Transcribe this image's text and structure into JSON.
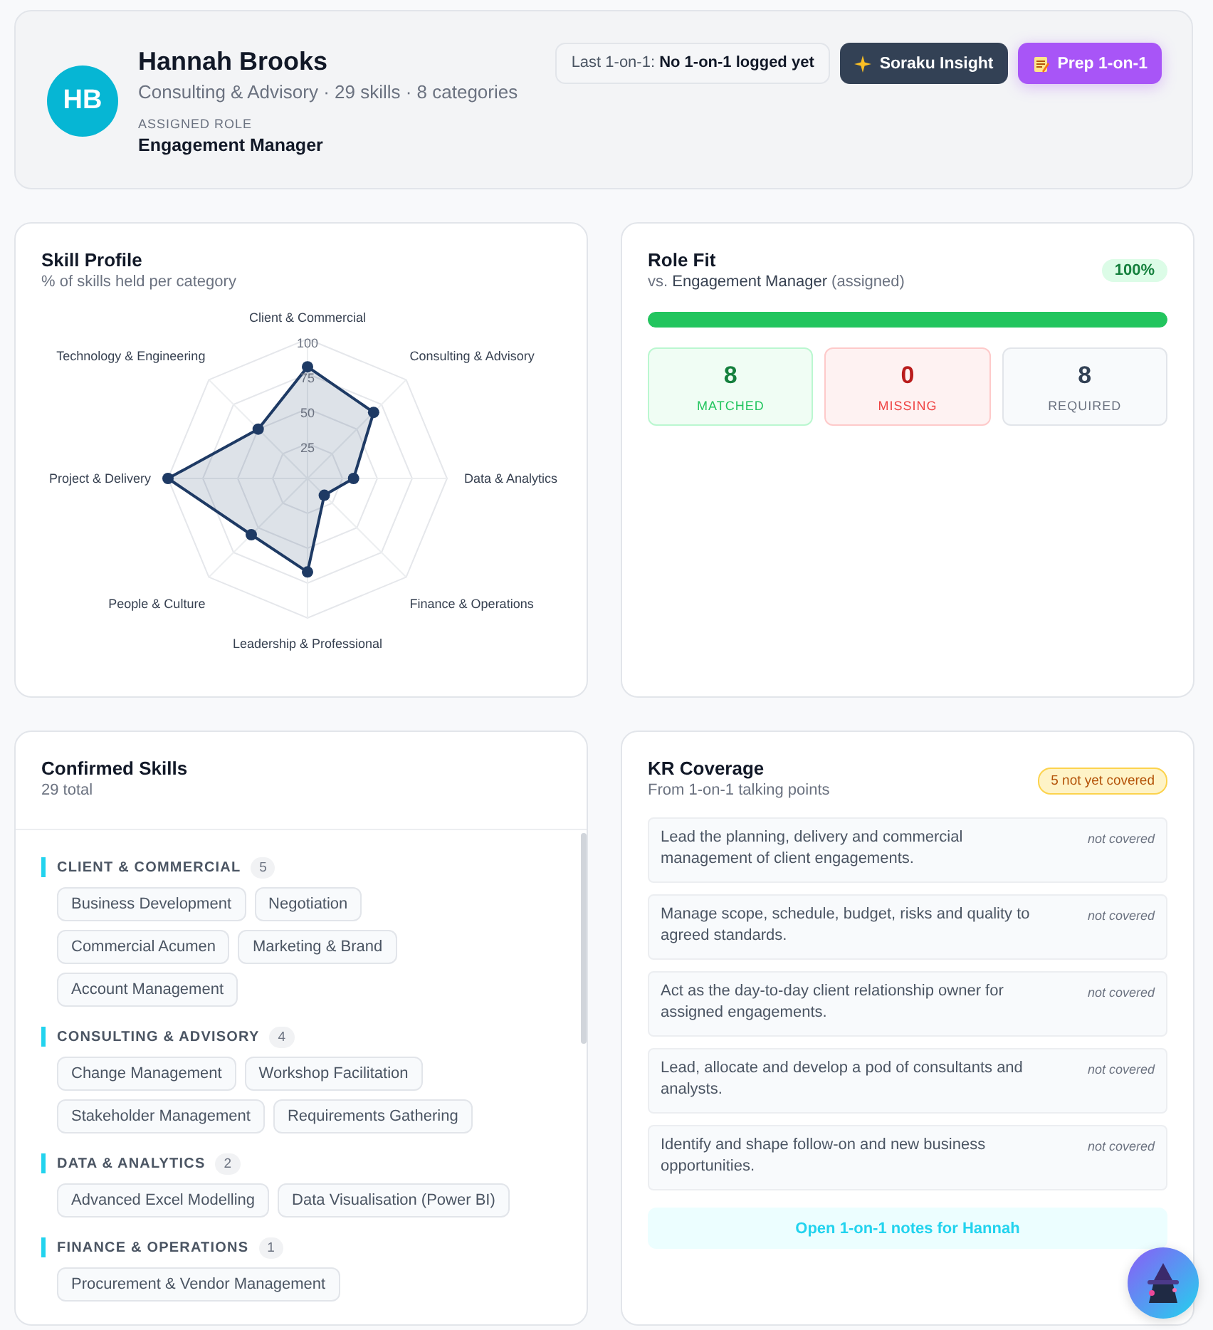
{
  "profile": {
    "initials": "HB",
    "name": "Hannah Brooks",
    "summary": "Consulting & Advisory · 29 skills · 8 categories",
    "role_label": "ASSIGNED ROLE",
    "role": "Engagement Manager",
    "last_one_on_one": "Last 1-on-1: **No 1-on-1 logged yet**",
    "buttons": [
      {
        "kind": "insight",
        "label": "Soraku Insight"
      },
      {
        "kind": "prep",
        "label": "Prep 1-on-1"
      }
    ]
  },
  "skill_profile": {
    "title": "Skill Profile",
    "subtitle": "% of skills held per category",
    "chart_data": {
      "type": "radar",
      "categories": [
        "Client & Commercial",
        "Consulting & Advisory",
        "Data & Analytics",
        "Finance & Operations",
        "Leadership & Professional",
        "People & Culture",
        "Project & Delivery",
        "Technology & Engineering"
      ],
      "series": [
        {
          "color": "#1e3a64",
          "values": [
            80,
            67,
            33,
            17,
            67,
            57,
            100,
            50
          ]
        }
      ],
      "ylim": [
        0,
        100
      ],
      "yticks": [
        25,
        50,
        75,
        100
      ]
    }
  },
  "role_fit": {
    "title": "Role Fit",
    "subtitle": "vs. **Engagement Manager** (assigned)",
    "badge": "100%",
    "level": 1.0,
    "stats": [
      {
        "kind": "matched",
        "value": "8",
        "label": "MATCHED"
      },
      {
        "kind": "missing",
        "value": "0",
        "label": "MISSING"
      },
      {
        "kind": "required",
        "value": "8",
        "label": "REQUIRED"
      }
    ]
  },
  "confirmed_skills": {
    "title": "Confirmed Skills",
    "subtitle": "29 total",
    "categories": [
      {
        "name": "CLIENT & COMMERCIAL",
        "count": "5",
        "skills": [
          "Business Development",
          "Negotiation",
          "Commercial Acumen",
          "Marketing & Brand",
          "Account Management"
        ]
      },
      {
        "name": "CONSULTING & ADVISORY",
        "count": "4",
        "skills": [
          "Change Management",
          "Workshop Facilitation",
          "Stakeholder Management",
          "Requirements Gathering"
        ]
      },
      {
        "name": "DATA & ANALYTICS",
        "count": "2",
        "skills": [
          "Advanced Excel Modelling",
          "Data Visualisation (Power BI)"
        ]
      },
      {
        "name": "FINANCE & OPERATIONS",
        "count": "1",
        "skills": [
          "Procurement & Vendor Management"
        ]
      }
    ]
  },
  "kr_coverage": {
    "title": "KR Coverage",
    "subtitle": "From 1-on-1 talking points",
    "badge": "5 not yet covered",
    "items": [
      {
        "text": "Lead the planning, delivery and commercial management of client engagements.",
        "status": "not covered"
      },
      {
        "text": "Manage scope, schedule, budget, risks and quality to agreed standards.",
        "status": "not covered"
      },
      {
        "text": "Act as the day-to-day client relationship owner for assigned engagements.",
        "status": "not covered"
      },
      {
        "text": "Lead, allocate and develop a pod of consultants and analysts.",
        "status": "not covered"
      },
      {
        "text": "Identify and shape follow-on and new business opportunities.",
        "status": "not covered"
      }
    ],
    "action": "Open 1-on-1 notes for Hannah"
  }
}
